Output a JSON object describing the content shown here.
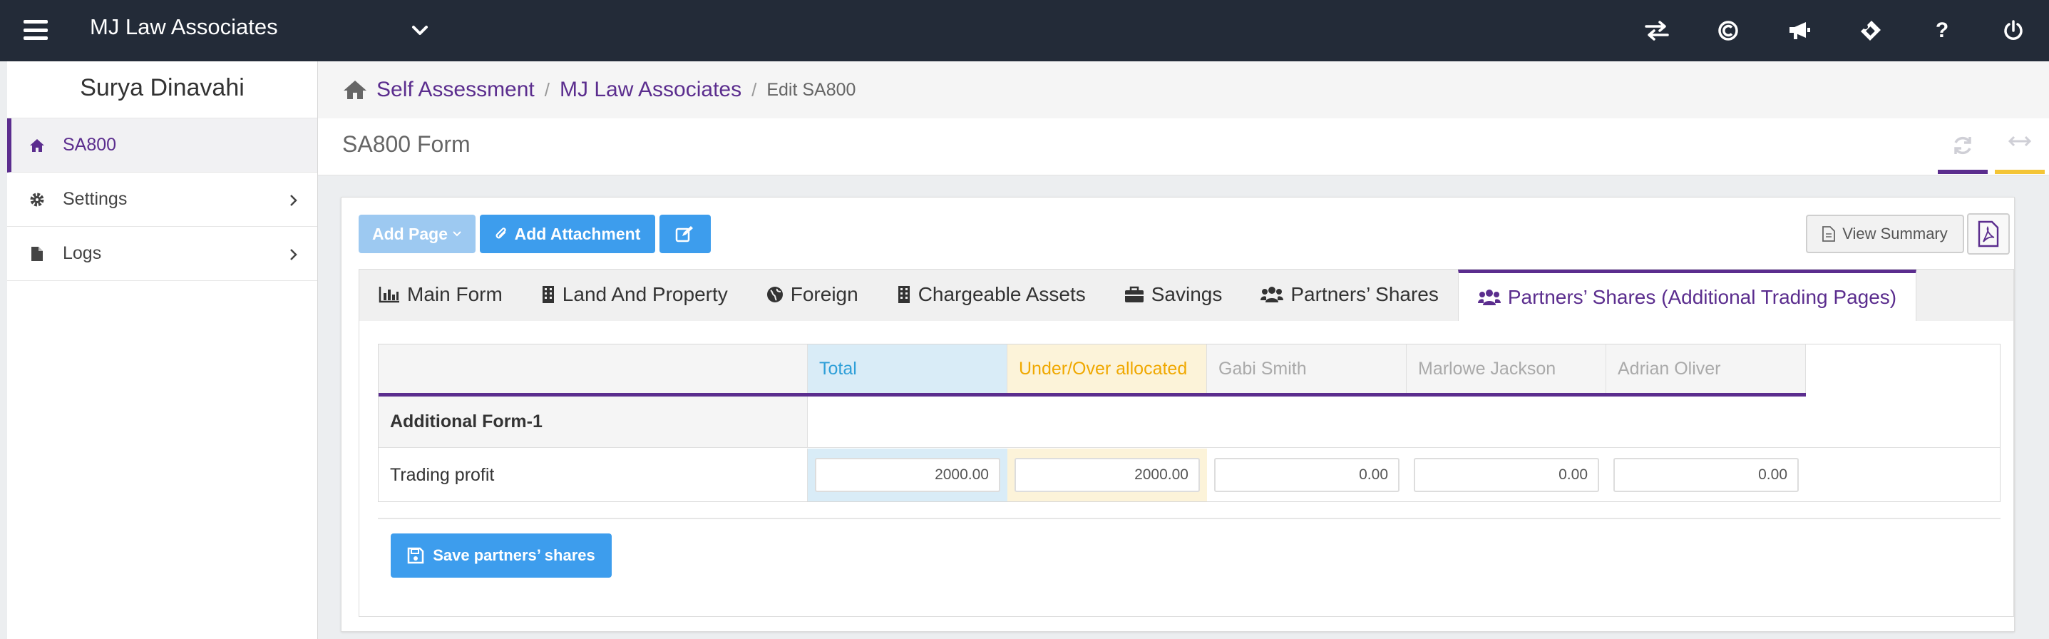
{
  "app": {
    "title": "MJ Law Associates",
    "accent_color": "#5b2d8e",
    "topbar_icons": [
      "switch-icon",
      "copyright-icon",
      "megaphone-icon",
      "ticket-icon",
      "help-icon",
      "power-icon"
    ],
    "help_glyph": "?"
  },
  "sidebar": {
    "user_name": "Surya Dinavahi",
    "items": [
      {
        "label": "SA800",
        "icon": "home-icon"
      },
      {
        "label": "Settings",
        "icon": "gear-icon"
      },
      {
        "label": "Logs",
        "icon": "file-icon"
      }
    ]
  },
  "breadcrumb": {
    "items": [
      "Self Assessment",
      "MJ Law Associates"
    ],
    "current": "Edit SA800",
    "separator": "/"
  },
  "page": {
    "title": "SA800 Form",
    "header_buttons": [
      "refresh-icon",
      "expand-icon"
    ]
  },
  "toolbar": {
    "add_page_label": "Add Page",
    "add_attachment_label": "Add Attachment",
    "view_summary_label": "View Summary"
  },
  "tabs": [
    {
      "label": "Main Form",
      "icon": "chart-icon"
    },
    {
      "label": "Land And Property",
      "icon": "building-icon"
    },
    {
      "label": "Foreign",
      "icon": "globe-icon"
    },
    {
      "label": "Chargeable Assets",
      "icon": "building-icon"
    },
    {
      "label": "Savings",
      "icon": "briefcase-icon"
    },
    {
      "label": "Partners’ Shares",
      "icon": "users-icon"
    },
    {
      "label": "Partners’ Shares (Additional Trading Pages)",
      "icon": "users-icon",
      "active": true
    }
  ],
  "table": {
    "columns": [
      "Total",
      "Under/Over allocated",
      "Gabi Smith",
      "Marlowe Jackson",
      "Adrian Oliver"
    ],
    "section_label": "Additional Form-1",
    "row_label": "Trading profit",
    "row_values": [
      "2000.00",
      "2000.00",
      "0.00",
      "0.00",
      "0.00"
    ]
  },
  "save_button_label": "Save partners’ shares"
}
